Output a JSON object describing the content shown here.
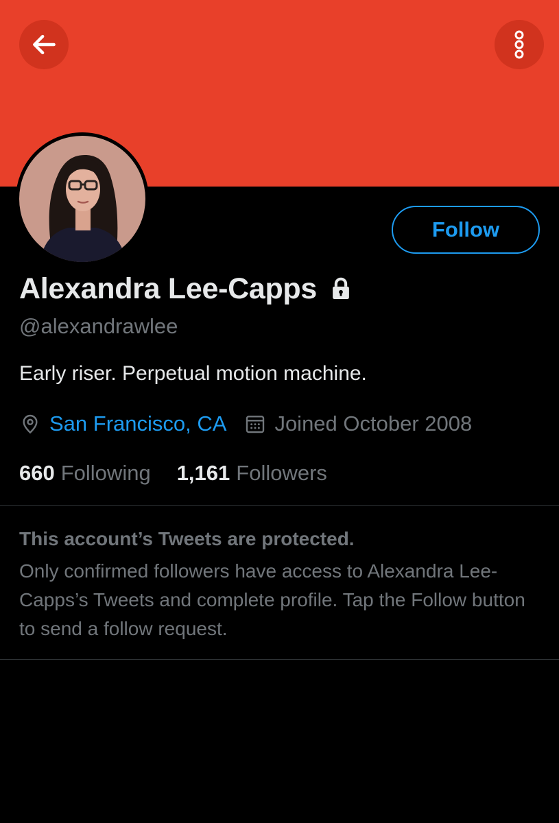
{
  "colors": {
    "banner": "#e8402a",
    "accent": "#1d9bf0",
    "text_primary": "#e7e9ea",
    "text_secondary": "#71767b",
    "background": "#000000"
  },
  "header": {
    "back_icon": "arrow-left-icon",
    "more_icon": "more-vertical-icon"
  },
  "profile": {
    "display_name": "Alexandra Lee-Capps",
    "protected_icon": "lock-icon",
    "handle": "@alexandrawlee",
    "bio": "Early riser. Perpetual motion machine.",
    "location": "San Francisco, CA",
    "location_icon": "location-pin-icon",
    "joined": "Joined October 2008",
    "joined_icon": "calendar-icon",
    "follow_label": "Follow"
  },
  "stats": {
    "following_count": "660",
    "following_label": "Following",
    "followers_count": "1,161",
    "followers_label": "Followers"
  },
  "protected_notice": {
    "title": "This account’s Tweets are protected.",
    "body": "Only confirmed followers have access to Alexandra Lee-Capps’s Tweets and complete profile. Tap the Follow button to send a follow request."
  }
}
